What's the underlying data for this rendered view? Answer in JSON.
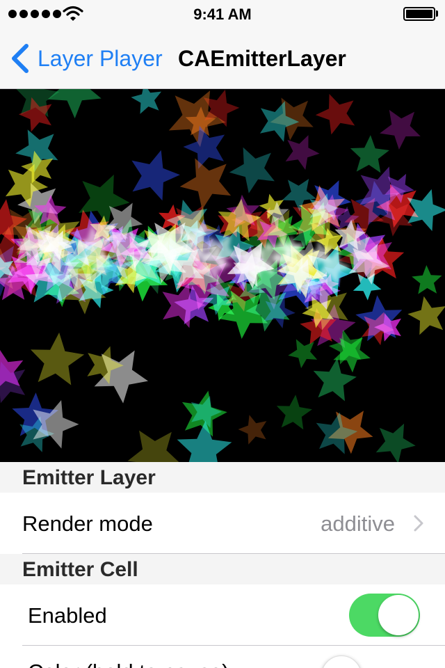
{
  "status_bar": {
    "time": "9:41 AM",
    "signal_icon": "signal-dots-icon",
    "wifi_icon": "wifi-icon",
    "battery_icon": "battery-icon",
    "battery_level": 1.0
  },
  "nav": {
    "back_label": "Layer Player",
    "back_icon": "chevron-left-icon",
    "title": "CAEmitterLayer",
    "tint_color": "#1f7ff4"
  },
  "emitter": {
    "particle_shape": "star",
    "background_color": "#000000"
  },
  "sections": {
    "emitter_layer": {
      "header": "Emitter Layer",
      "render_mode_label": "Render mode",
      "render_mode_value": "additive",
      "disclosure_icon": "chevron-right-icon"
    },
    "emitter_cell": {
      "header": "Emitter Cell",
      "enabled_label": "Enabled",
      "enabled_on": true,
      "toggle_on_color": "#4cd964",
      "next_row_label": "Color (hold to pause)"
    }
  }
}
